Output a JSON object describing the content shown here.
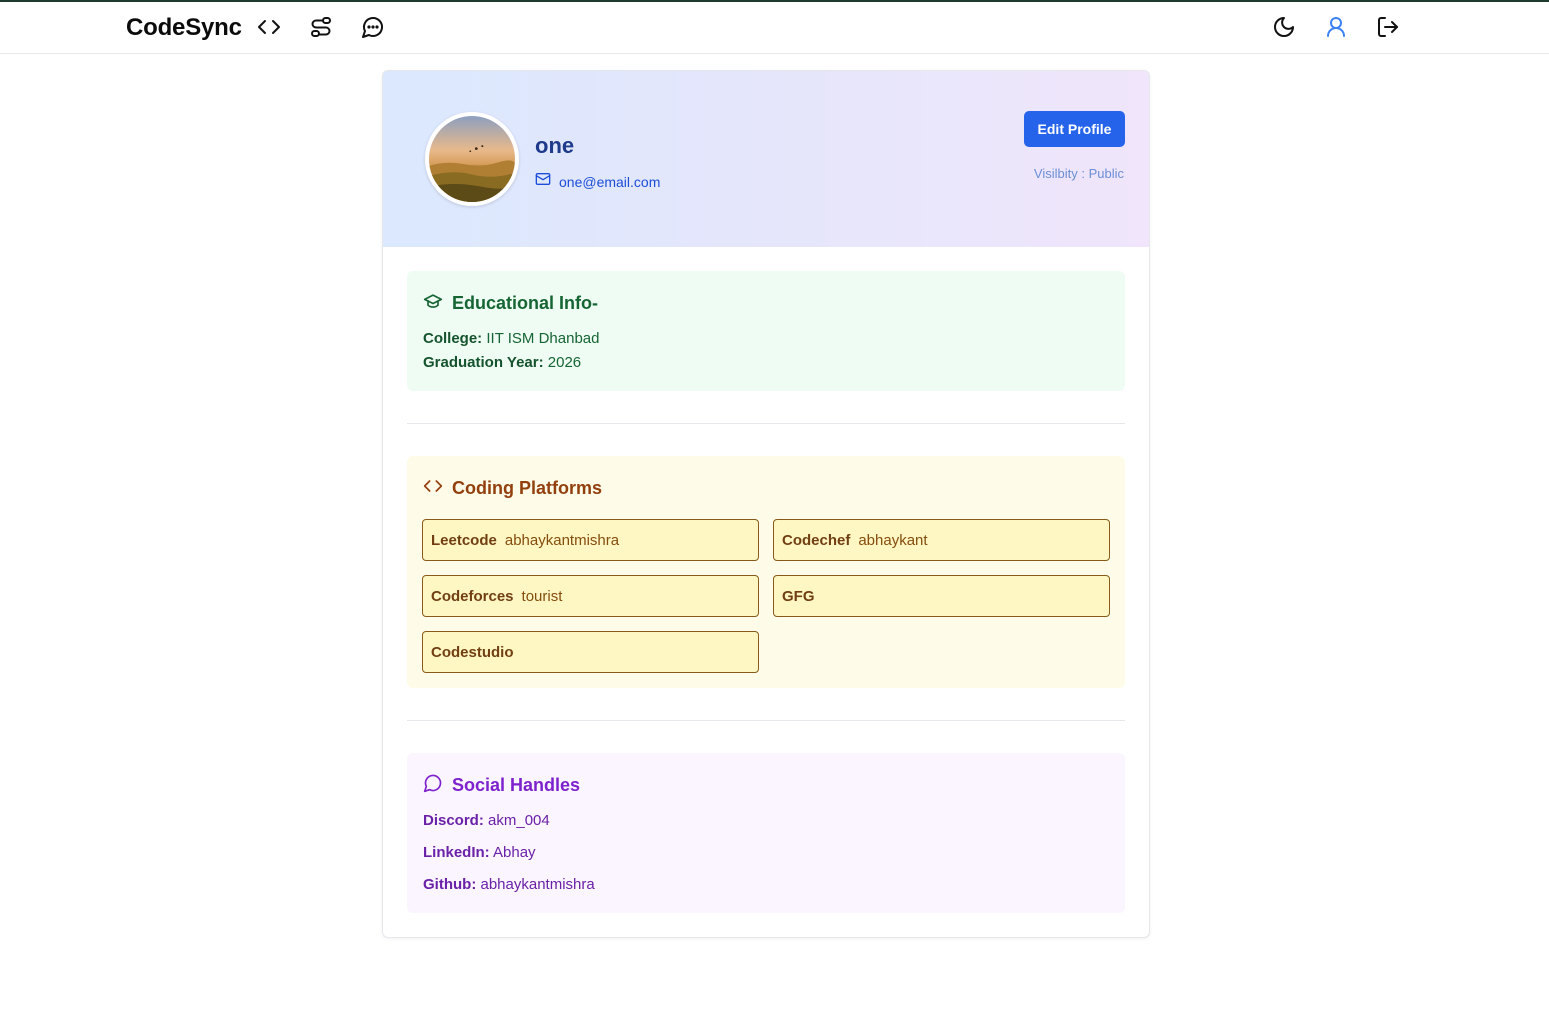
{
  "navbar": {
    "brand": "CodeSync",
    "icons": [
      "code-icon",
      "workflow-icon",
      "chat-icon",
      "moon-icon",
      "user-icon",
      "logout-icon"
    ]
  },
  "profile": {
    "name": "one",
    "email": "one@email.com",
    "edit_button": "Edit Profile",
    "visibility": "Visilbity : Public"
  },
  "education": {
    "title": "Educational Info-",
    "college_label": "College:",
    "college_value": "IIT ISM Dhanbad",
    "grad_label": "Graduation Year:",
    "grad_value": "2026"
  },
  "coding": {
    "title": "Coding Platforms",
    "platforms": [
      {
        "name": "Leetcode",
        "handle": "abhaykantmishra"
      },
      {
        "name": "Codechef",
        "handle": "abhaykant"
      },
      {
        "name": "Codeforces",
        "handle": "tourist"
      },
      {
        "name": "GFG",
        "handle": ""
      },
      {
        "name": "Codestudio",
        "handle": ""
      }
    ]
  },
  "social": {
    "title": "Social Handles",
    "discord_label": "Discord:",
    "discord_value": "akm_004",
    "linkedin_label": "LinkedIn:",
    "linkedin_value": "Abhay",
    "github_label": "Github:",
    "github_value": "abhaykantmishra"
  },
  "colors": {
    "primary": "#2563eb",
    "education_bg": "#effcf3",
    "coding_bg": "#fefbe8",
    "social_bg": "#faf5fe"
  }
}
